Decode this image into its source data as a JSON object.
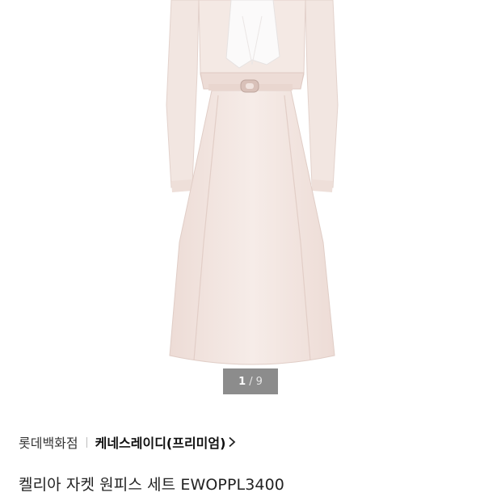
{
  "gallery": {
    "current": "1",
    "separator": "/",
    "total": "9"
  },
  "product": {
    "store": "롯데백화점",
    "brand": "케네스레이디(프리미엄)",
    "title": "켈리아 자켓 원피스 세트 EWOPPL3400"
  },
  "icons": {
    "brand_arrow": "chevron-right-icon"
  },
  "colors": {
    "dress": "#f3e7e2",
    "dress_shadow": "#e2cfc8",
    "counter_bg": "#787878"
  }
}
